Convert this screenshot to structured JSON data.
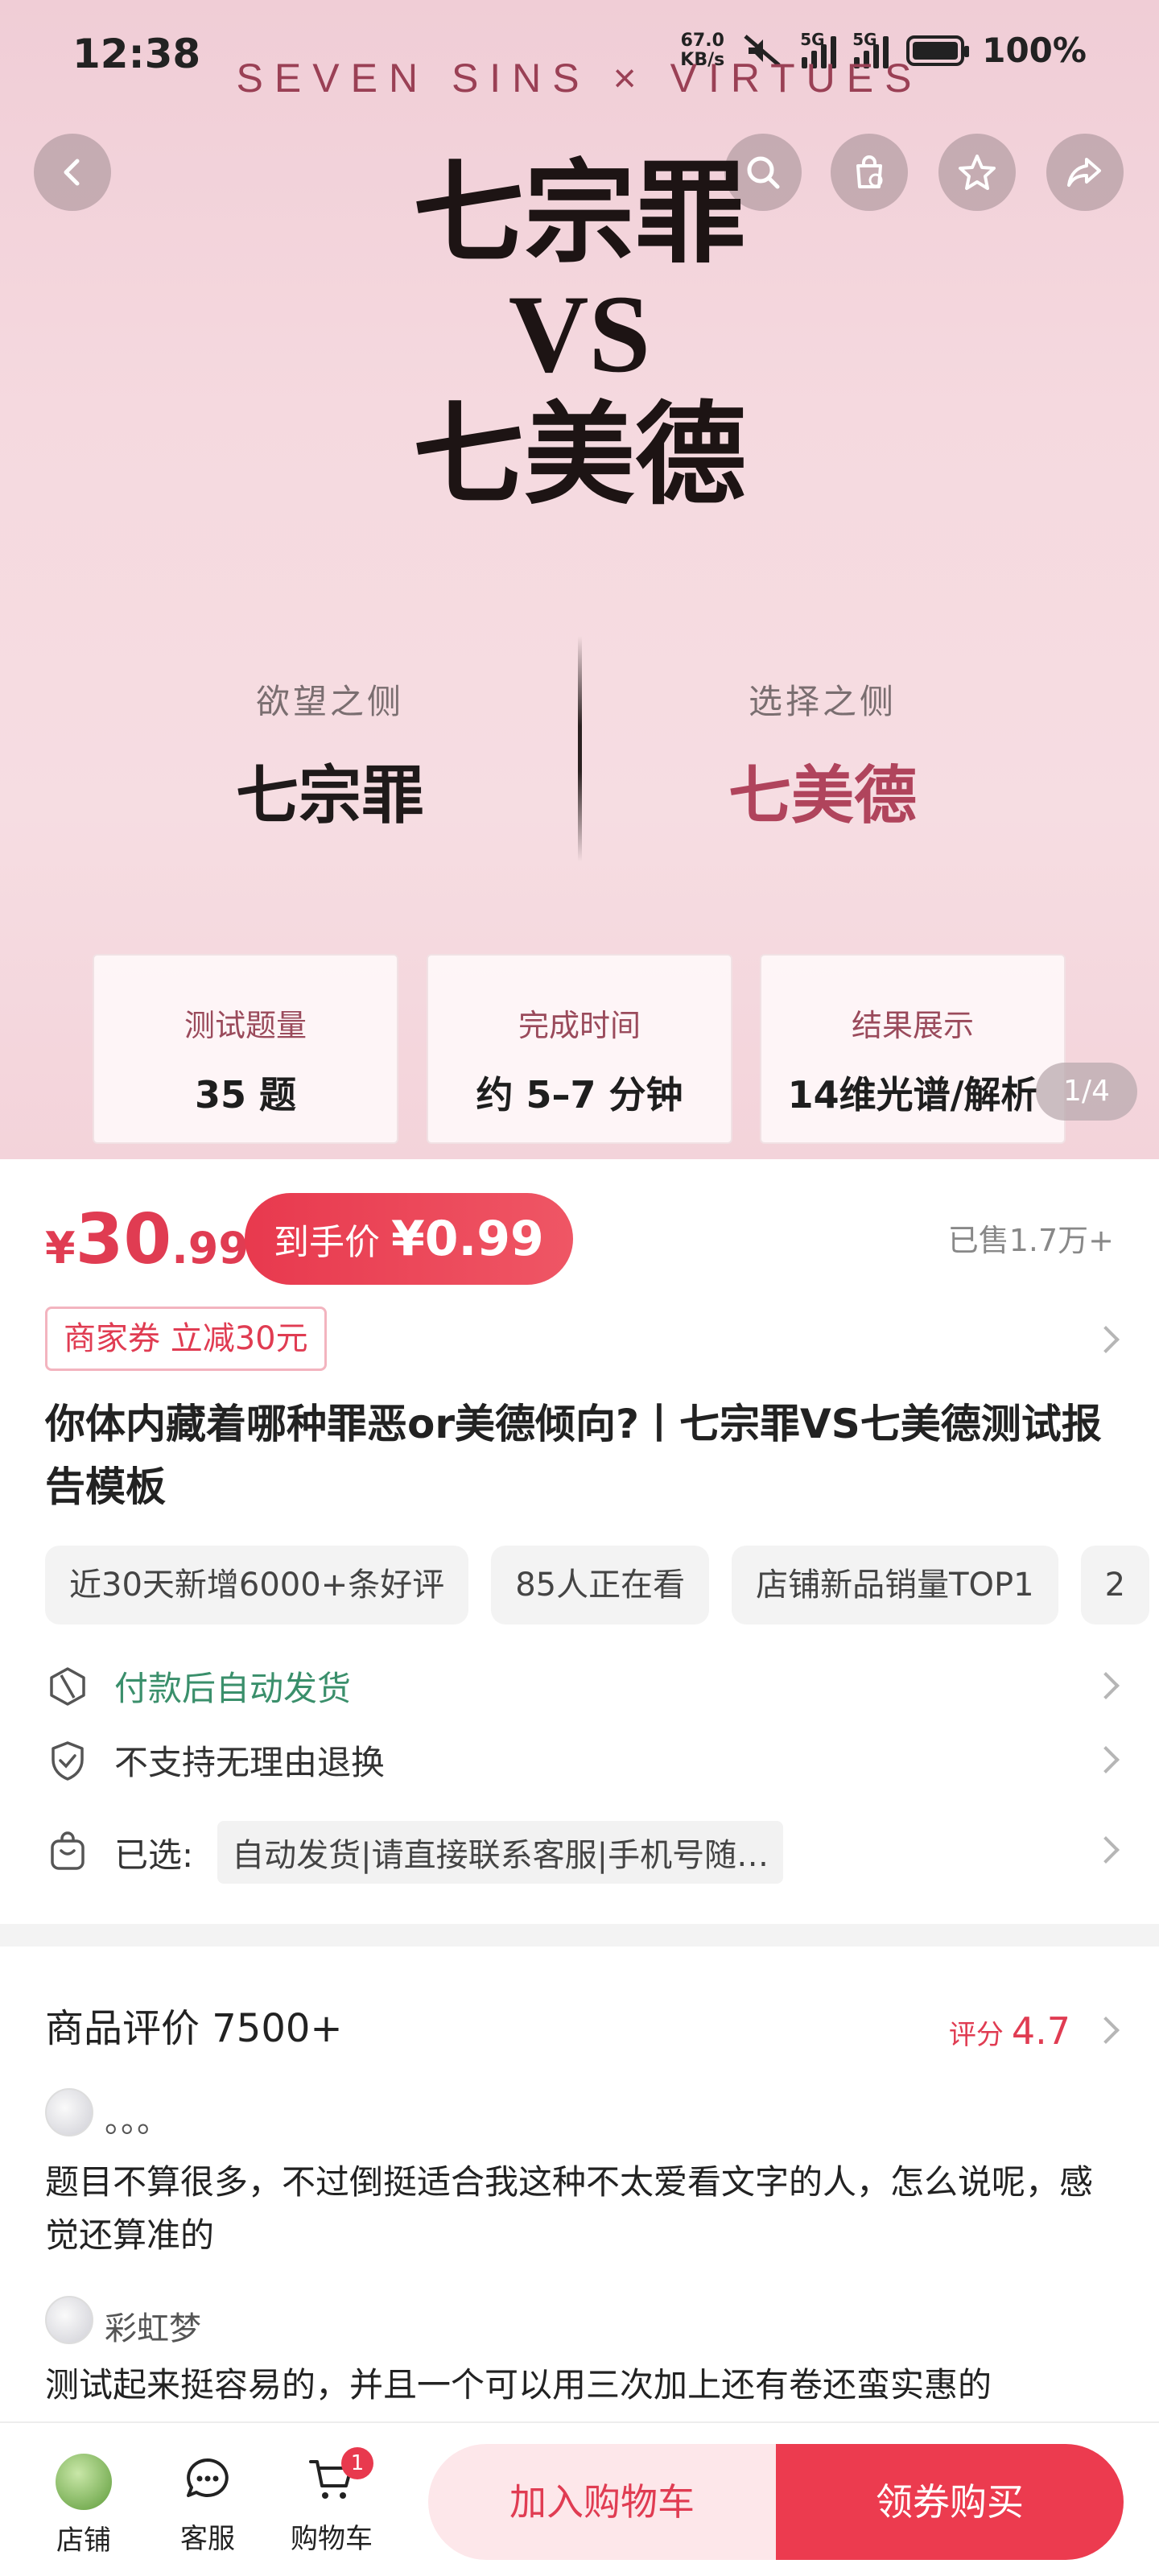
{
  "status_bar": {
    "time": "12:38",
    "net_speed_value": "67.0",
    "net_speed_unit": "KB/s",
    "sig1": "5G",
    "sig2": "5G",
    "battery": "100%"
  },
  "hero": {
    "brand_line": "SEVEN SINS × VIRTUES",
    "title_line1": "七宗罪",
    "title_line2": "VS",
    "title_line3": "七美德",
    "left_label": "欲望之侧",
    "left_value": "七宗罪",
    "right_label": "选择之侧",
    "right_value": "七美德",
    "cards": [
      {
        "label": "测试题量",
        "value": "35 题"
      },
      {
        "label": "完成时间",
        "value": "约 5–7 分钟"
      },
      {
        "label": "结果展示",
        "value": "14维光谱/解析"
      }
    ],
    "page_indicator": "1/4"
  },
  "product": {
    "price_currency": "¥",
    "price_int": "30",
    "price_dec": ".99",
    "deal_label": "到手价",
    "deal_price": "¥0.99",
    "sold": "已售1.7万+",
    "coupon": "商家券 立减30元",
    "title": "你体内藏着哪种罪恶or美德倾向?丨七宗罪VS七美德测试报告模板",
    "tags": [
      "近30天新增6000+条好评",
      "85人正在看",
      "店铺新品销量TOP1",
      "2"
    ],
    "delivery": "付款后自动发货",
    "return_policy": "不支持无理由退换",
    "selected_label": "已选:",
    "selected_value": "自动发货|请直接联系客服|手机号随…"
  },
  "reviews": {
    "title": "商品评价 7500+",
    "score_label": "评分",
    "score_value": "4.7",
    "items": [
      {
        "name": "。。。",
        "text": "题目不算很多，不过倒挺适合我这种不太爱看文字的人，怎么说呢，感觉还算准的"
      },
      {
        "name": "彩虹梦",
        "text": "测试起来挺容易的，并且一个可以用三次加上还有卷还蛮实惠的"
      }
    ]
  },
  "bottom_bar": {
    "shop": "店铺",
    "service": "客服",
    "cart": "购物车",
    "cart_badge": "1",
    "add_to_cart": "加入购物车",
    "buy": "领券购买"
  },
  "colors": {
    "accent": "#e03c52",
    "green": "#3a8f6b",
    "virtue": "#b0445c"
  }
}
